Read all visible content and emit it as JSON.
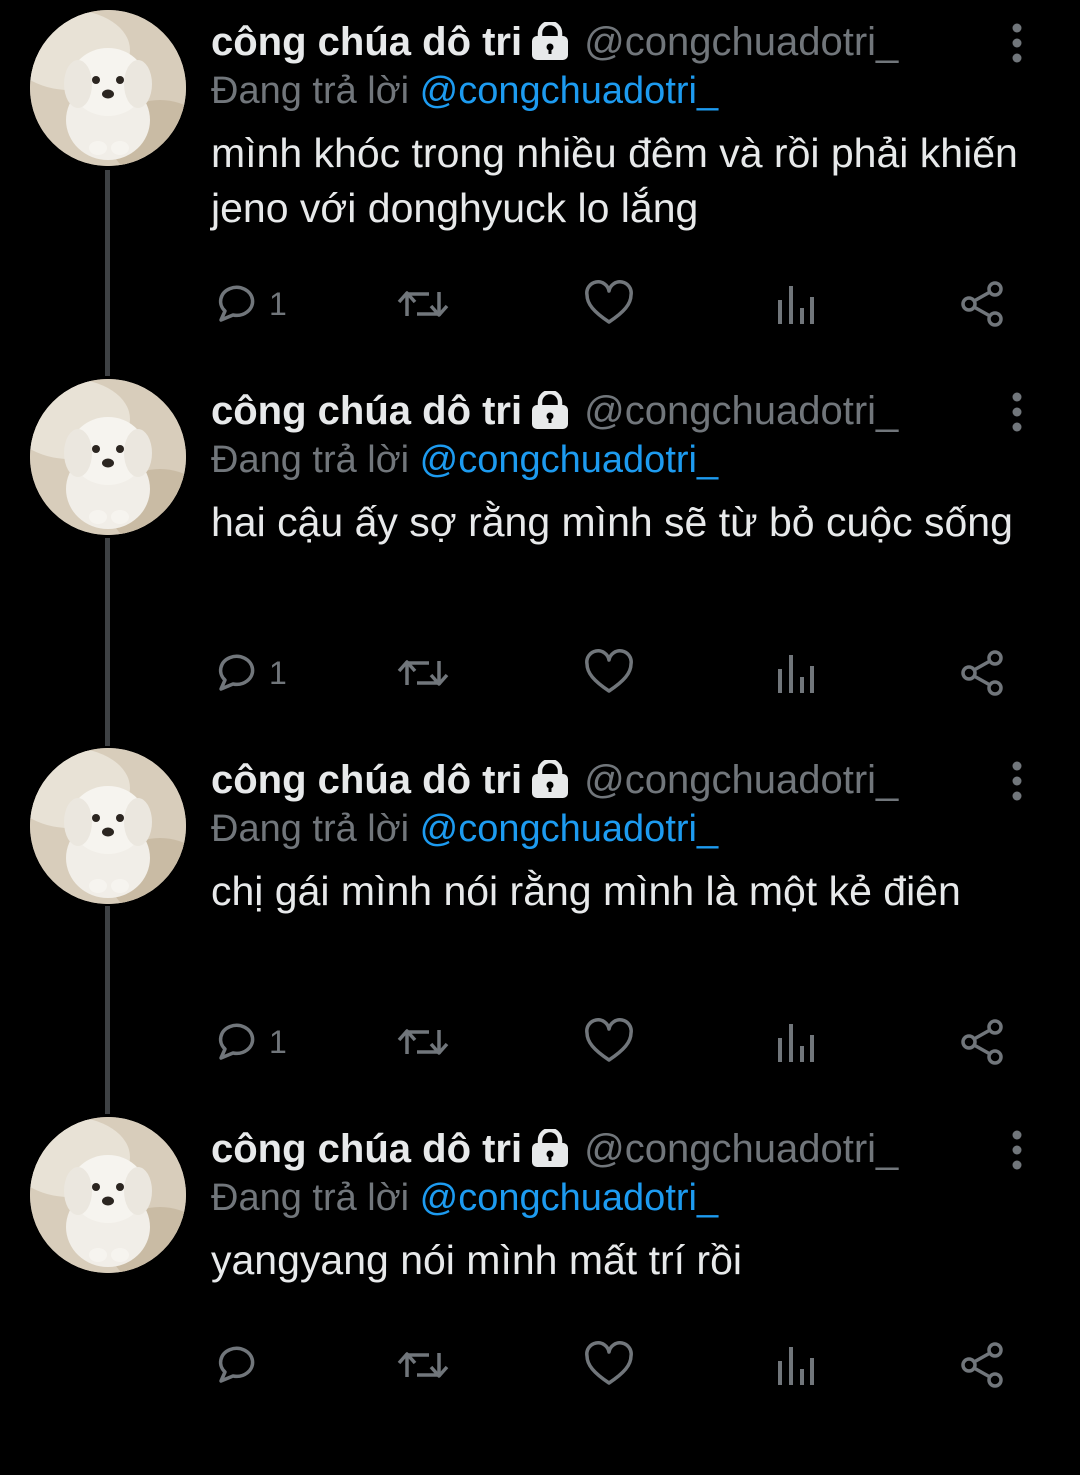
{
  "colors": {
    "background": "#000000",
    "text_primary": "#e7e9ea",
    "text_secondary": "#71767b",
    "mention": "#1d9bf0",
    "thread_line": "#3e4144"
  },
  "icons": {
    "lock": "lock-icon",
    "more": "more-vertical-icon",
    "reply": "reply-bubble-icon",
    "retweet": "retweet-icon",
    "like": "heart-icon",
    "views": "views-bars-icon",
    "share": "share-icon"
  },
  "tweets": [
    {
      "display_name": "công chúa dô tri",
      "handle": "@congchuadotri_",
      "reply_prefix": "Đang trả lời ",
      "reply_mention": "@congchuadotri_",
      "text": "mình khóc trong nhiều đêm và rồi phải khiến jeno với donghyuck lo lắng",
      "reply_count": "1"
    },
    {
      "display_name": "công chúa dô tri",
      "handle": "@congchuadotri_",
      "reply_prefix": "Đang trả lời ",
      "reply_mention": "@congchuadotri_",
      "text": "hai cậu ấy sợ rằng mình sẽ từ bỏ cuộc sống",
      "reply_count": "1"
    },
    {
      "display_name": "công chúa dô tri",
      "handle": "@congchuadotri_",
      "reply_prefix": "Đang trả lời ",
      "reply_mention": "@congchuadotri_",
      "text": "chị gái mình nói rằng mình là một kẻ điên",
      "reply_count": "1"
    },
    {
      "display_name": "công chúa dô tri",
      "handle": "@congchuadotri_",
      "reply_prefix": "Đang trả lời ",
      "reply_mention": "@congchuadotri_",
      "text": "yangyang nói mình mất trí rồi",
      "reply_count": ""
    }
  ]
}
